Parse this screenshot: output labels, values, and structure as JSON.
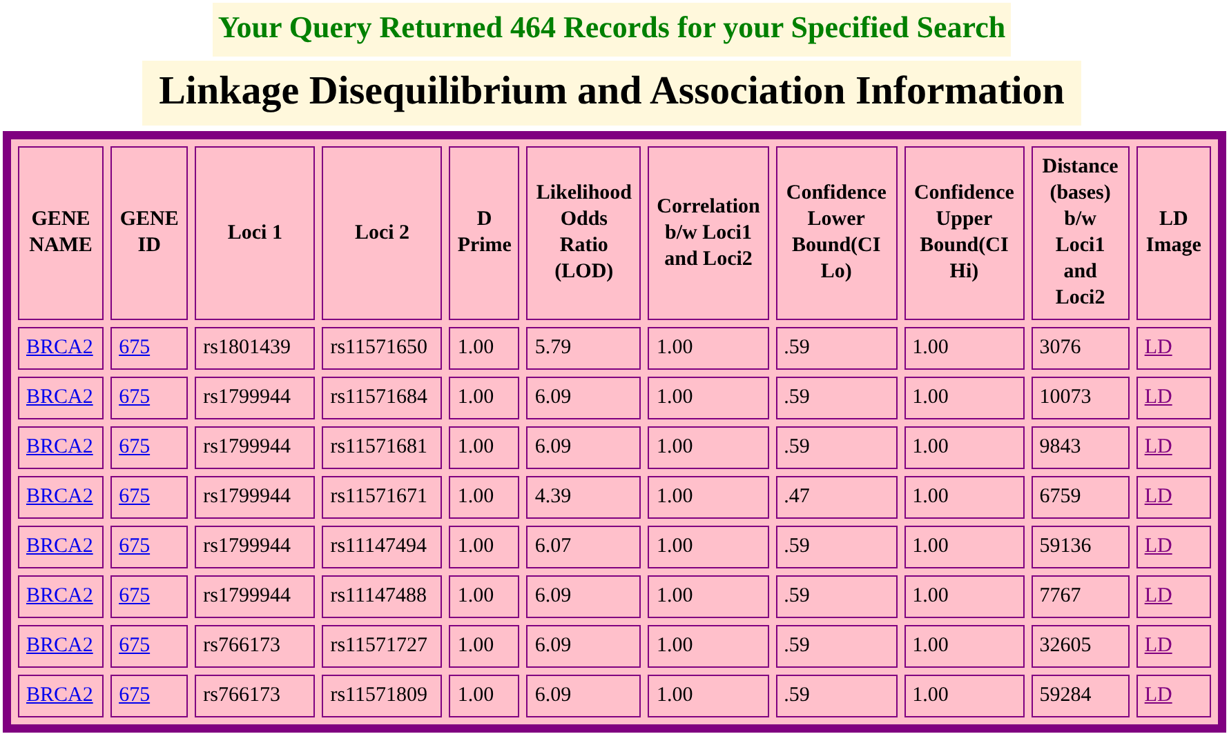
{
  "query_summary": "Your Query Returned 464 Records for your Specified Search",
  "page_title": "Linkage Disequilibrium and Association Information",
  "table": {
    "columns": [
      "GENE NAME",
      "GENE ID",
      "Loci 1",
      "Loci 2",
      "D Prime",
      "Likelihood Odds Ratio (LOD)",
      "Correlation b/w Loci1 and Loci2",
      "Confidence Lower Bound(CI Lo)",
      "Confidence Upper Bound(CI Hi)",
      "Distance (bases) b/w Loci1 and Loci2",
      "LD Image"
    ],
    "rows": [
      {
        "gene_name": "BRCA2",
        "gene_id": "675",
        "loci_1": "rs1801439",
        "loci_2": "rs11571650",
        "d_prime": "1.00",
        "lod": "5.79",
        "correlation": "1.00",
        "ci_lo": ".59",
        "ci_hi": "1.00",
        "distance": "3076",
        "ld_image": "LD"
      },
      {
        "gene_name": "BRCA2",
        "gene_id": "675",
        "loci_1": "rs1799944",
        "loci_2": "rs11571684",
        "d_prime": "1.00",
        "lod": "6.09",
        "correlation": "1.00",
        "ci_lo": ".59",
        "ci_hi": "1.00",
        "distance": "10073",
        "ld_image": "LD"
      },
      {
        "gene_name": "BRCA2",
        "gene_id": "675",
        "loci_1": "rs1799944",
        "loci_2": "rs11571681",
        "d_prime": "1.00",
        "lod": "6.09",
        "correlation": "1.00",
        "ci_lo": ".59",
        "ci_hi": "1.00",
        "distance": "9843",
        "ld_image": "LD"
      },
      {
        "gene_name": "BRCA2",
        "gene_id": "675",
        "loci_1": "rs1799944",
        "loci_2": "rs11571671",
        "d_prime": "1.00",
        "lod": "4.39",
        "correlation": "1.00",
        "ci_lo": ".47",
        "ci_hi": "1.00",
        "distance": "6759",
        "ld_image": "LD"
      },
      {
        "gene_name": "BRCA2",
        "gene_id": "675",
        "loci_1": "rs1799944",
        "loci_2": "rs11147494",
        "d_prime": "1.00",
        "lod": "6.07",
        "correlation": "1.00",
        "ci_lo": ".59",
        "ci_hi": "1.00",
        "distance": "59136",
        "ld_image": "LD"
      },
      {
        "gene_name": "BRCA2",
        "gene_id": "675",
        "loci_1": "rs1799944",
        "loci_2": "rs11147488",
        "d_prime": "1.00",
        "lod": "6.09",
        "correlation": "1.00",
        "ci_lo": ".59",
        "ci_hi": "1.00",
        "distance": "7767",
        "ld_image": "LD"
      },
      {
        "gene_name": "BRCA2",
        "gene_id": "675",
        "loci_1": "rs766173",
        "loci_2": "rs11571727",
        "d_prime": "1.00",
        "lod": "6.09",
        "correlation": "1.00",
        "ci_lo": ".59",
        "ci_hi": "1.00",
        "distance": "32605",
        "ld_image": "LD"
      },
      {
        "gene_name": "BRCA2",
        "gene_id": "675",
        "loci_1": "rs766173",
        "loci_2": "rs11571809",
        "d_prime": "1.00",
        "lod": "6.09",
        "correlation": "1.00",
        "ci_lo": ".59",
        "ci_hi": "1.00",
        "distance": "59284",
        "ld_image": "LD"
      }
    ]
  }
}
